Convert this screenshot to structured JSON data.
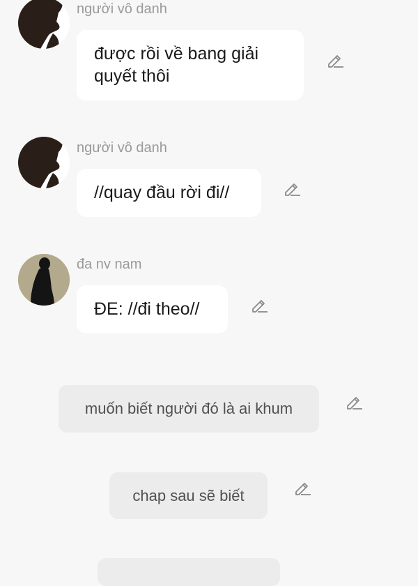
{
  "messages": [
    {
      "sender": "người vô danh",
      "text": "được rồi về bang giải quyết thôi",
      "avatar_icon": "silhouette-profile-icon"
    },
    {
      "sender": "người vô danh",
      "text": "//quay đầu rời đi//",
      "avatar_icon": "silhouette-profile-icon"
    },
    {
      "sender": "đa nv nam",
      "text": "ĐE: //đi theo//",
      "avatar_icon": "standing-figure-icon"
    }
  ],
  "narrations": [
    {
      "text": "muốn biết người đó là ai khum"
    },
    {
      "text": "chap sau sẽ biết"
    }
  ],
  "icons": {
    "edit": "pencil-edit-icon"
  },
  "colors": {
    "background": "#f7f7f7",
    "bubble": "#ffffff",
    "narration_bubble": "#ececec",
    "sender_text": "#9a9a9a",
    "icon": "#8a8a8a"
  }
}
